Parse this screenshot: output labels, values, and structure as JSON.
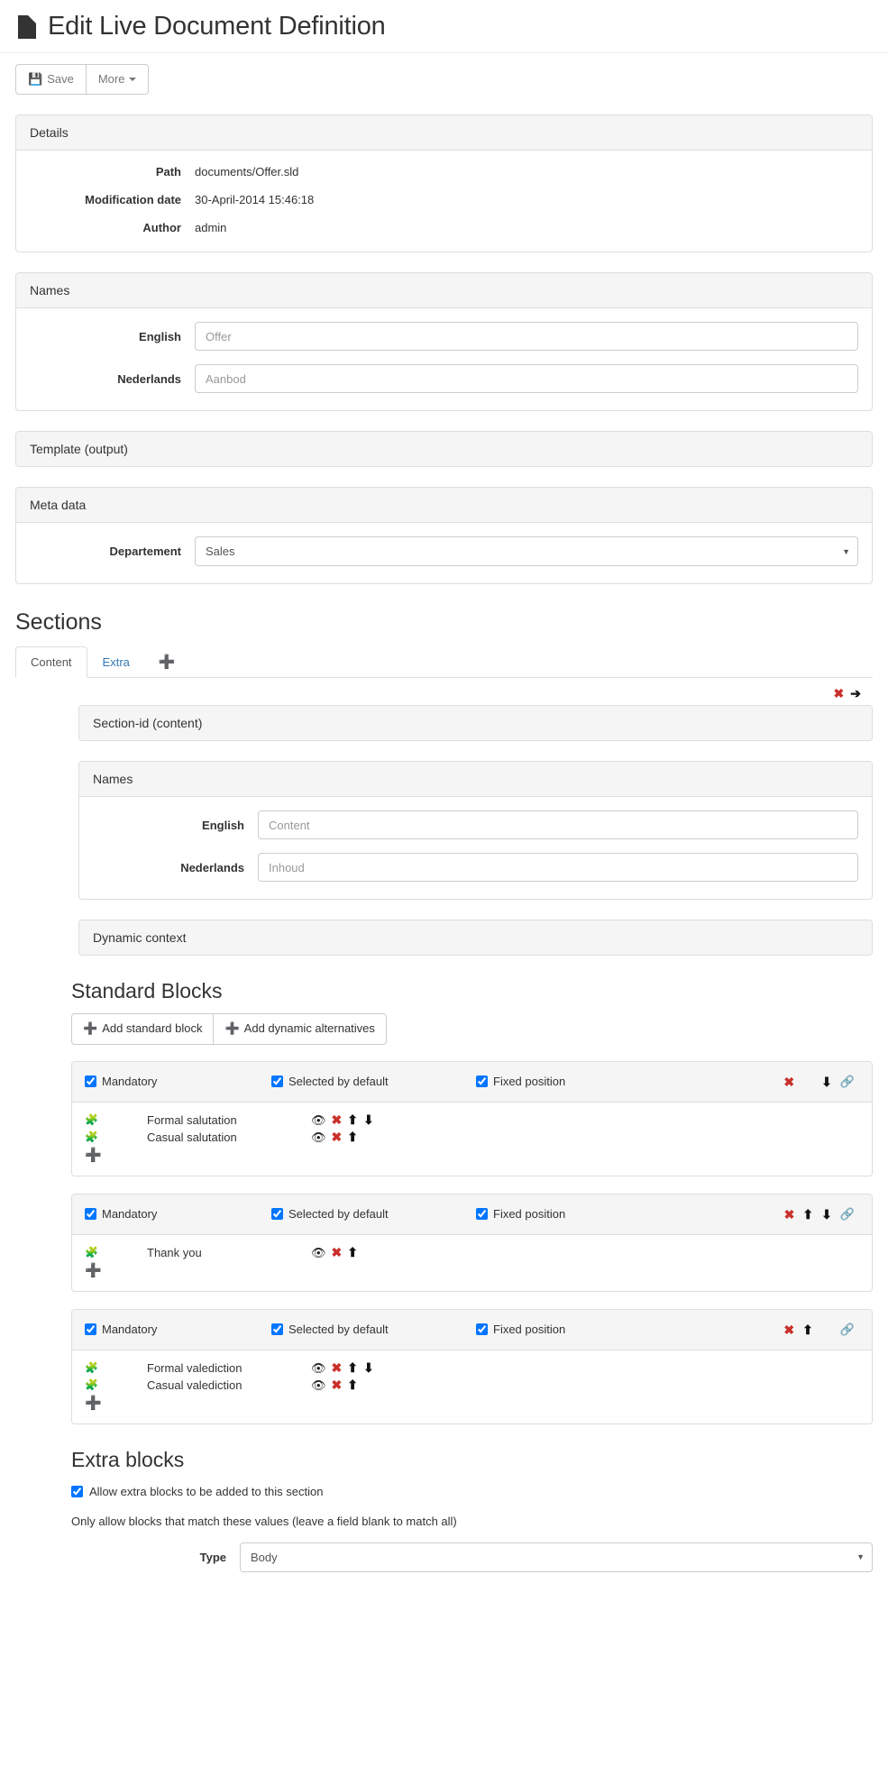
{
  "header": {
    "icon": "file-icon",
    "title": "Edit Live Document Definition"
  },
  "toolbar": {
    "save_label": "Save",
    "save_icon": "floppy-disk-icon",
    "more_label": "More"
  },
  "details_panel": {
    "heading": "Details",
    "rows": [
      {
        "label": "Path",
        "value": "documents/Offer.sld"
      },
      {
        "label": "Modification date",
        "value": "30-April-2014 15:46:18"
      },
      {
        "label": "Author",
        "value": "admin"
      }
    ]
  },
  "names_panel": {
    "heading": "Names",
    "fields": [
      {
        "label": "English",
        "value": "",
        "placeholder": "Offer"
      },
      {
        "label": "Nederlands",
        "value": "",
        "placeholder": "Aanbod"
      }
    ]
  },
  "template_panel": {
    "heading": "Template (output)"
  },
  "meta_panel": {
    "heading": "Meta data",
    "field": {
      "label": "Departement",
      "selected": "Sales",
      "options": [
        "Sales"
      ]
    }
  },
  "sections": {
    "title": "Sections",
    "tabs": [
      {
        "label": "Content",
        "active": true
      },
      {
        "label": "Extra",
        "active": false
      }
    ],
    "add_tab_icon": "plus-icon",
    "toolbar_icons": [
      "remove-section-icon",
      "move-section-right-icon"
    ],
    "section_id_heading": "Section-id (content)",
    "names_heading": "Names",
    "names_fields": [
      {
        "label": "English",
        "value": "",
        "placeholder": "Content"
      },
      {
        "label": "Nederlands",
        "value": "",
        "placeholder": "Inhoud"
      }
    ],
    "dynamic_context_heading": "Dynamic context"
  },
  "standard_blocks": {
    "title": "Standard Blocks",
    "buttons": [
      {
        "label": "Add standard block"
      },
      {
        "label": "Add dynamic alternatives"
      }
    ],
    "checkbox_labels": {
      "mandatory": "Mandatory",
      "selected_by_default": "Selected by default",
      "fixed_position": "Fixed position"
    },
    "groups": [
      {
        "mandatory": true,
        "selected_by_default": true,
        "fixed_position": true,
        "head_actions": [
          "delete-icon",
          "move-down-icon",
          "link-icon"
        ],
        "items": [
          {
            "name": "Formal salutation",
            "actions": [
              "preview-icon",
              "delete-icon",
              "move-up-icon",
              "move-down-icon"
            ]
          },
          {
            "name": "Casual salutation",
            "actions": [
              "preview-icon",
              "delete-icon",
              "move-up-icon"
            ]
          }
        ]
      },
      {
        "mandatory": true,
        "selected_by_default": true,
        "fixed_position": true,
        "head_actions": [
          "delete-icon",
          "move-up-icon",
          "move-down-icon",
          "link-icon"
        ],
        "items": [
          {
            "name": "Thank you",
            "actions": [
              "preview-icon",
              "delete-icon",
              "move-up-icon"
            ]
          }
        ]
      },
      {
        "mandatory": true,
        "selected_by_default": true,
        "fixed_position": true,
        "head_actions": [
          "delete-icon",
          "move-up-icon",
          "link-icon"
        ],
        "items": [
          {
            "name": "Formal valediction",
            "actions": [
              "preview-icon",
              "delete-icon",
              "move-up-icon",
              "move-down-icon"
            ]
          },
          {
            "name": "Casual valediction",
            "actions": [
              "preview-icon",
              "delete-icon",
              "move-up-icon"
            ]
          }
        ]
      }
    ]
  },
  "extra_blocks": {
    "title": "Extra blocks",
    "allow_label": "Allow extra blocks to be added to this section",
    "allow_checked": true,
    "note": "Only allow blocks that match these values (leave a field blank to match all)",
    "type_label": "Type",
    "type_selected": "Body",
    "type_options": [
      "Body"
    ]
  },
  "colors": {
    "accent_link": "#337ab7",
    "danger": "#c9302c",
    "success": "#5cb85c",
    "panel_bg": "#f5f5f5",
    "border": "#dddddd"
  }
}
